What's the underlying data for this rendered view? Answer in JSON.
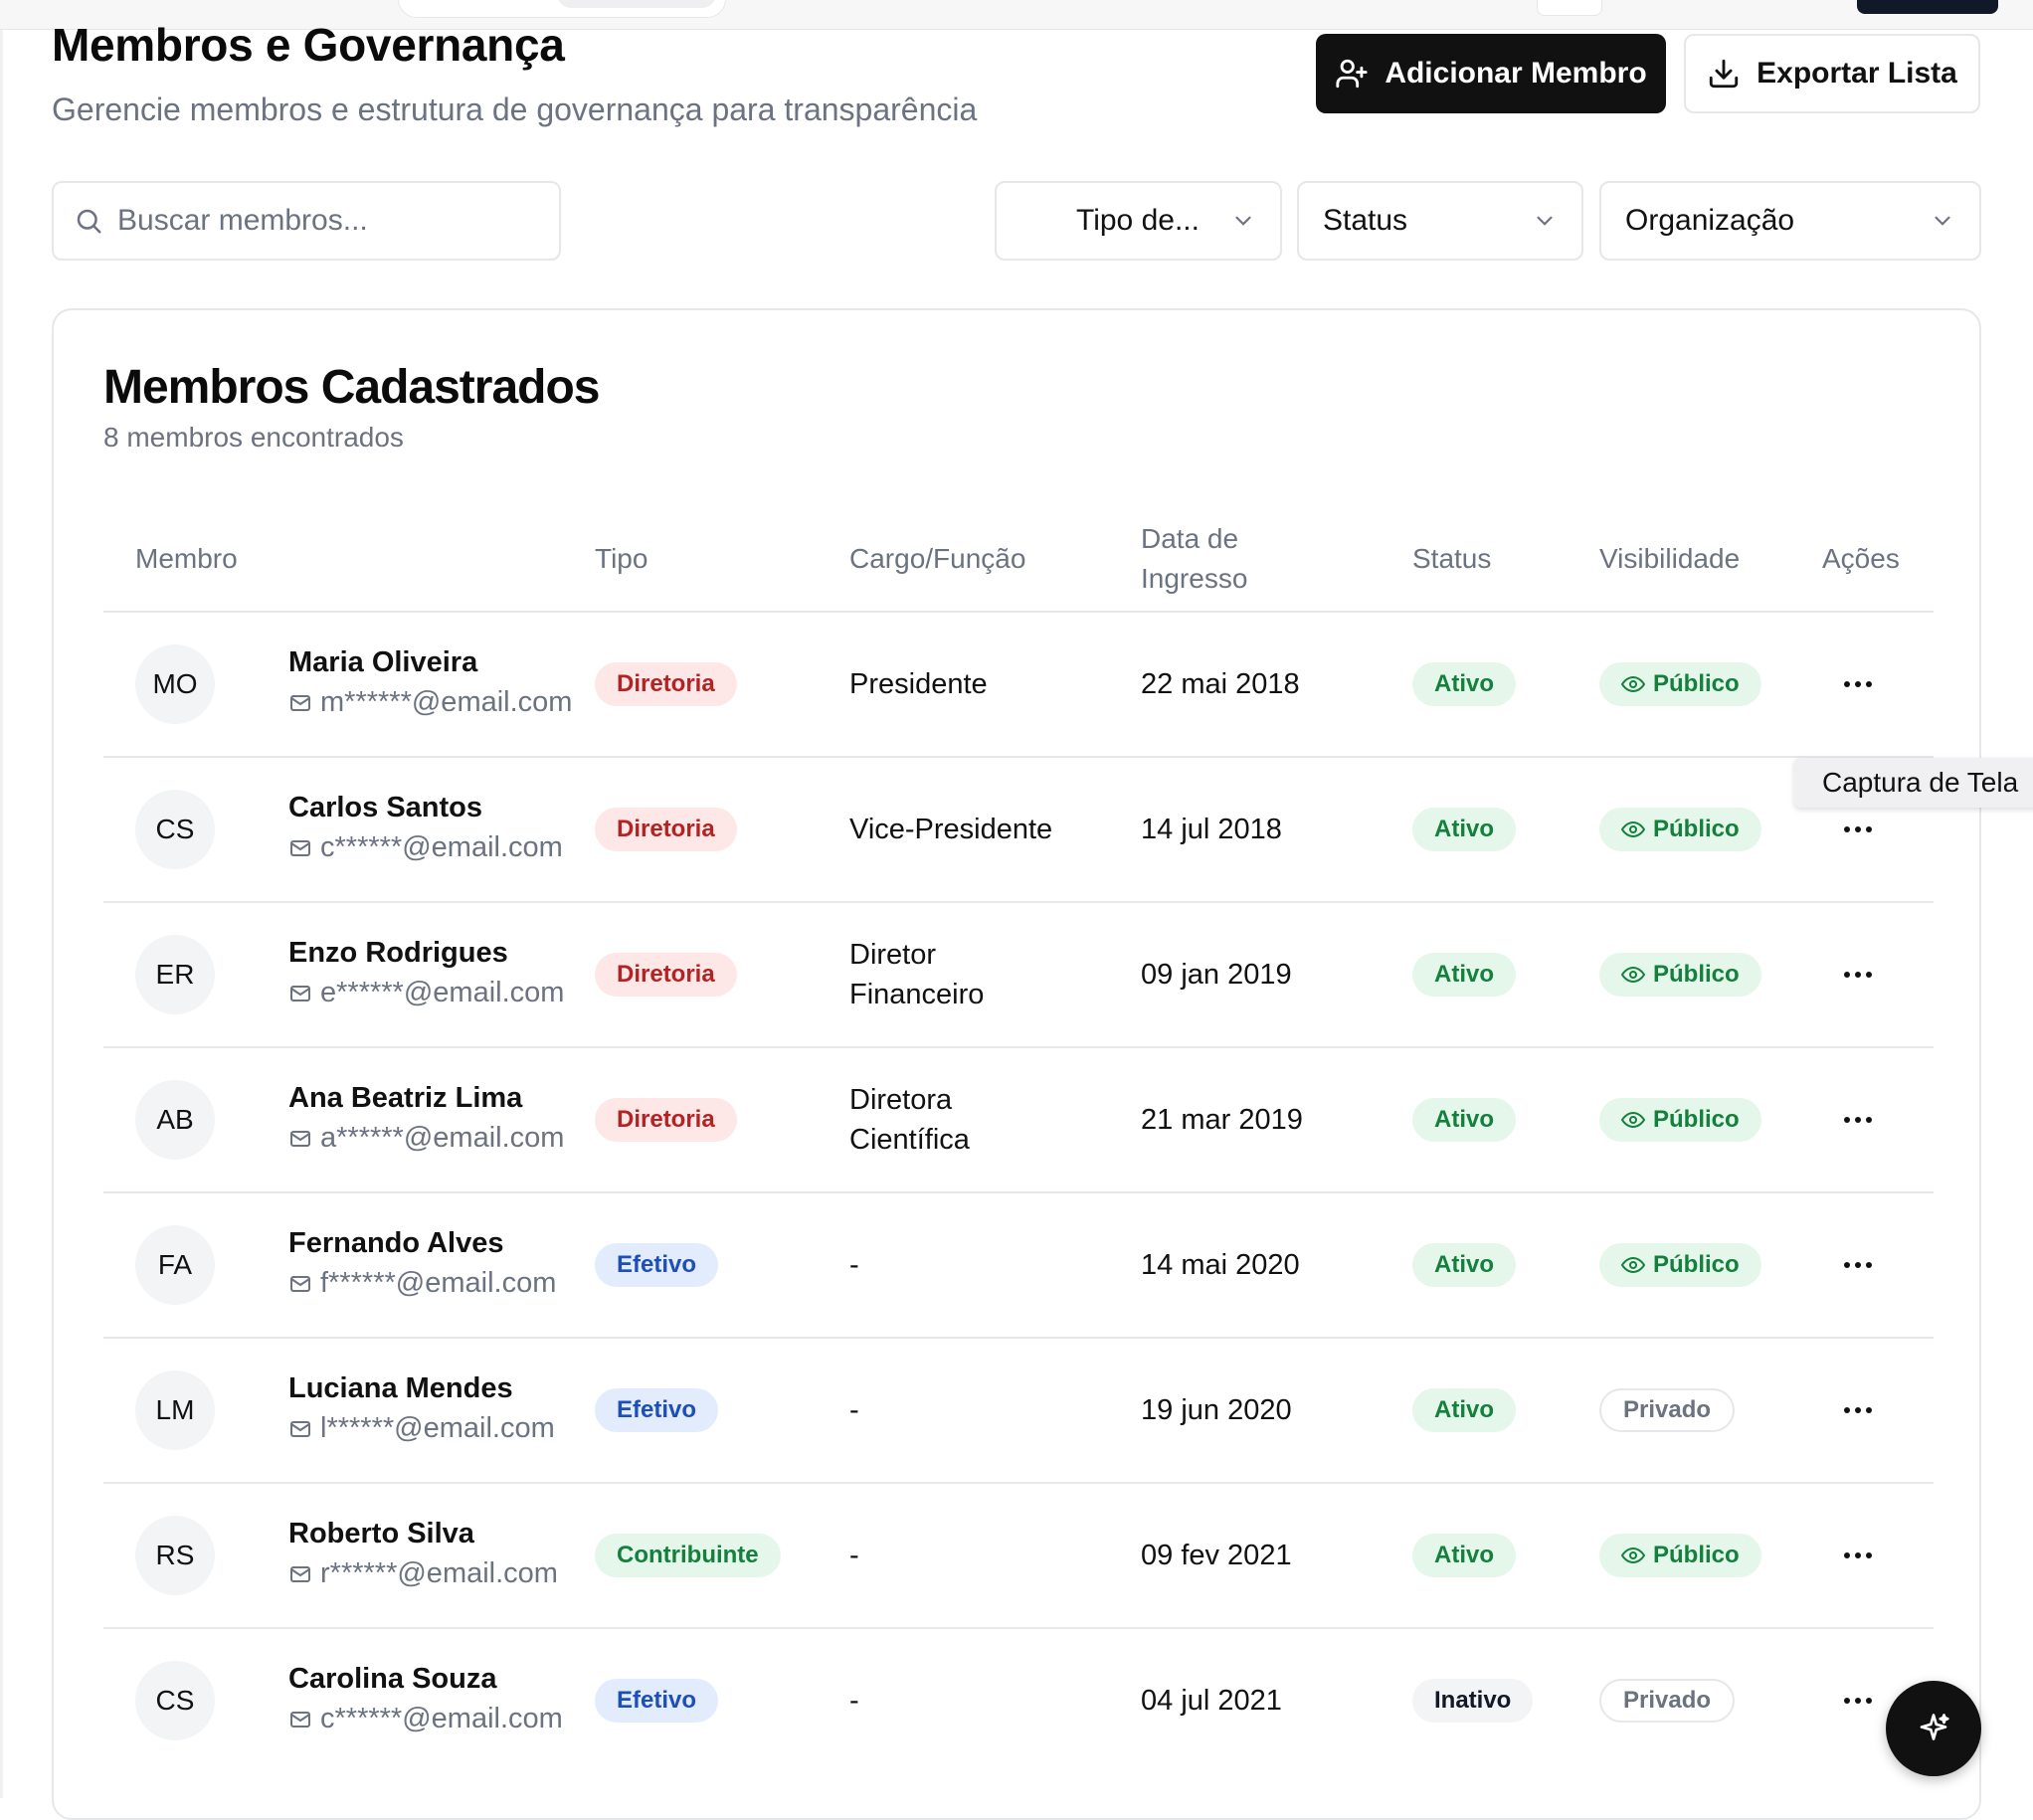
{
  "header": {
    "title": "Membros e Governança",
    "subtitle": "Gerencie membros e estrutura de governança para transparência",
    "add_button": "Adicionar Membro",
    "export_button": "Exportar Lista"
  },
  "filters": {
    "search_placeholder": "Buscar membros...",
    "tipo": "Tipo de...",
    "status": "Status",
    "organizacao": "Organização"
  },
  "card": {
    "title": "Membros Cadastrados",
    "subtitle": "8 membros encontrados"
  },
  "table": {
    "columns": [
      "Membro",
      "Tipo",
      "Cargo/Função",
      "Data de Ingresso",
      "Status",
      "Visibilidade",
      "Ações"
    ],
    "rows": [
      {
        "initials": "MO",
        "name": "Maria Oliveira",
        "email": "m******@email.com",
        "tipo": "Diretoria",
        "cargo": "Presidente",
        "data": "22 mai 2018",
        "status": "Ativo",
        "visibilidade": "Público"
      },
      {
        "initials": "CS",
        "name": "Carlos Santos",
        "email": "c******@email.com",
        "tipo": "Diretoria",
        "cargo": "Vice-Presidente",
        "data": "14 jul 2018",
        "status": "Ativo",
        "visibilidade": "Público"
      },
      {
        "initials": "ER",
        "name": "Enzo Rodrigues",
        "email": "e******@email.com",
        "tipo": "Diretoria",
        "cargo": "Diretor Financeiro",
        "data": "09 jan 2019",
        "status": "Ativo",
        "visibilidade": "Público"
      },
      {
        "initials": "AB",
        "name": "Ana Beatriz Lima",
        "email": "a******@email.com",
        "tipo": "Diretoria",
        "cargo": "Diretora Científica",
        "data": "21 mar 2019",
        "status": "Ativo",
        "visibilidade": "Público"
      },
      {
        "initials": "FA",
        "name": "Fernando Alves",
        "email": "f******@email.com",
        "tipo": "Efetivo",
        "cargo": "-",
        "data": "14 mai 2020",
        "status": "Ativo",
        "visibilidade": "Público"
      },
      {
        "initials": "LM",
        "name": "Luciana Mendes",
        "email": "l******@email.com",
        "tipo": "Efetivo",
        "cargo": "-",
        "data": "19 jun 2020",
        "status": "Ativo",
        "visibilidade": "Privado"
      },
      {
        "initials": "RS",
        "name": "Roberto Silva",
        "email": "r******@email.com",
        "tipo": "Contribuinte",
        "cargo": "-",
        "data": "09 fev 2021",
        "status": "Ativo",
        "visibilidade": "Público"
      },
      {
        "initials": "CS",
        "name": "Carolina Souza",
        "email": "c******@email.com",
        "tipo": "Efetivo",
        "cargo": "-",
        "data": "04 jul 2021",
        "status": "Inativo",
        "visibilidade": "Privado"
      }
    ]
  },
  "tooltip": "Captura de Tela",
  "icons": {
    "add_user": "user-plus-icon",
    "export": "download-icon",
    "search": "search-icon",
    "chevron": "chevron-down-icon",
    "email": "mail-icon",
    "visibility": "eye-icon",
    "actions": "more-horizontal-icon",
    "fab": "sparkles-icon"
  },
  "colors": {
    "primary": "#111111",
    "diretoria_bg": "#fde7e7",
    "diretoria_fg": "#b42323",
    "efetivo_bg": "#e3ecfd",
    "efetivo_fg": "#1d4fb8",
    "green_bg": "#e4f7ea",
    "green_fg": "#15803d"
  }
}
